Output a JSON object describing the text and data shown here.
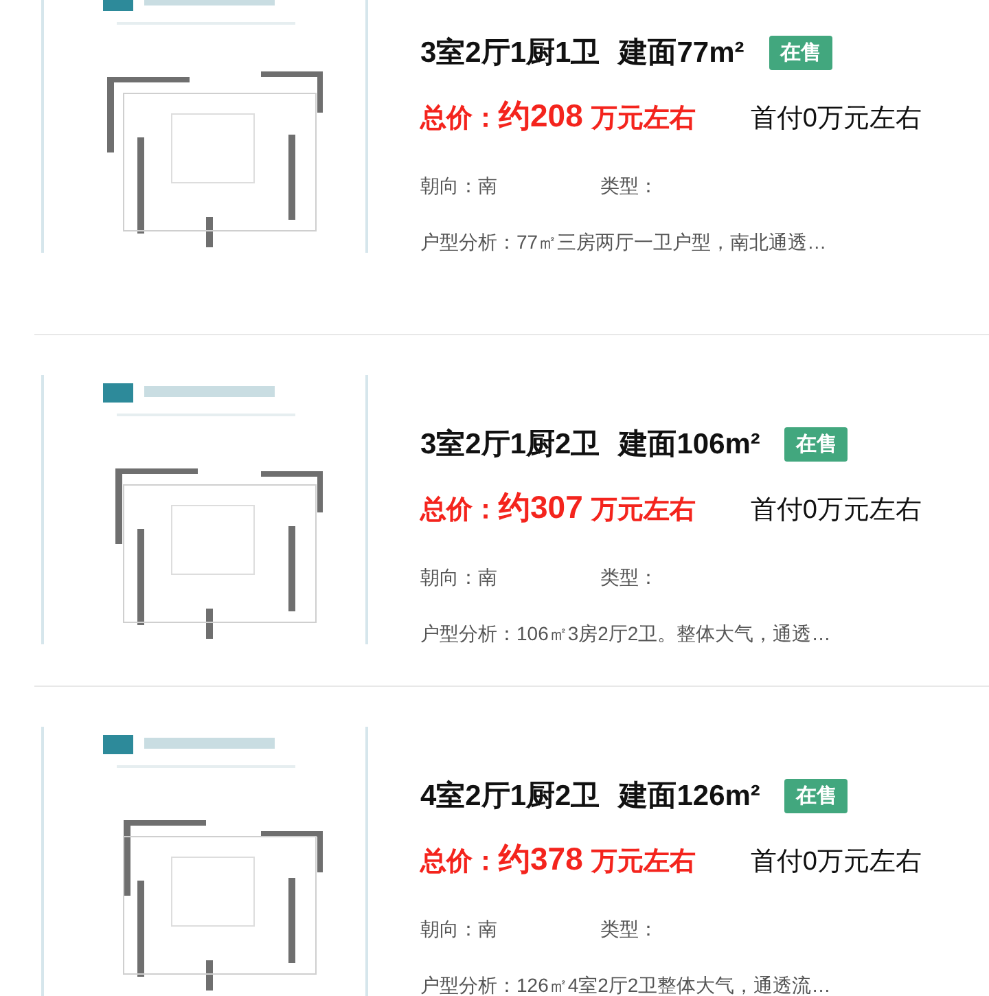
{
  "listings": [
    {
      "kind": "picture",
      "layout": "3室2厅1厨1卫",
      "area": "建面77m²",
      "status": "在售",
      "price_label": "总价：",
      "price": "约208",
      "price_unit": "万元左右",
      "down_payment": "首付0万元左右",
      "orientation": "朝向：南",
      "type_label": "类型：",
      "analysis": "户型分析：77㎡三房两厅一卫户型，南北通透…"
    },
    {
      "kind": "picture",
      "layout": "3室2厅1厨2卫",
      "area": "建面106m²",
      "status": "在售",
      "price_label": "总价：",
      "price": "约307",
      "price_unit": "万元左右",
      "down_payment": "首付0万元左右",
      "orientation": "朝向：南",
      "type_label": "类型：",
      "analysis": "户型分析：106㎡3房2厅2卫。整体大气，通透…"
    },
    {
      "kind": "picture",
      "layout": "4室2厅1厨2卫",
      "area": "建面126m²",
      "status": "在售",
      "price_label": "总价：",
      "price": "约378",
      "price_unit": "万元左右",
      "down_payment": "首付0万元左右",
      "orientation": "朝向：南",
      "type_label": "类型：",
      "analysis": "户型分析：126㎡4室2厅2卫整体大气，通透流…"
    }
  ]
}
